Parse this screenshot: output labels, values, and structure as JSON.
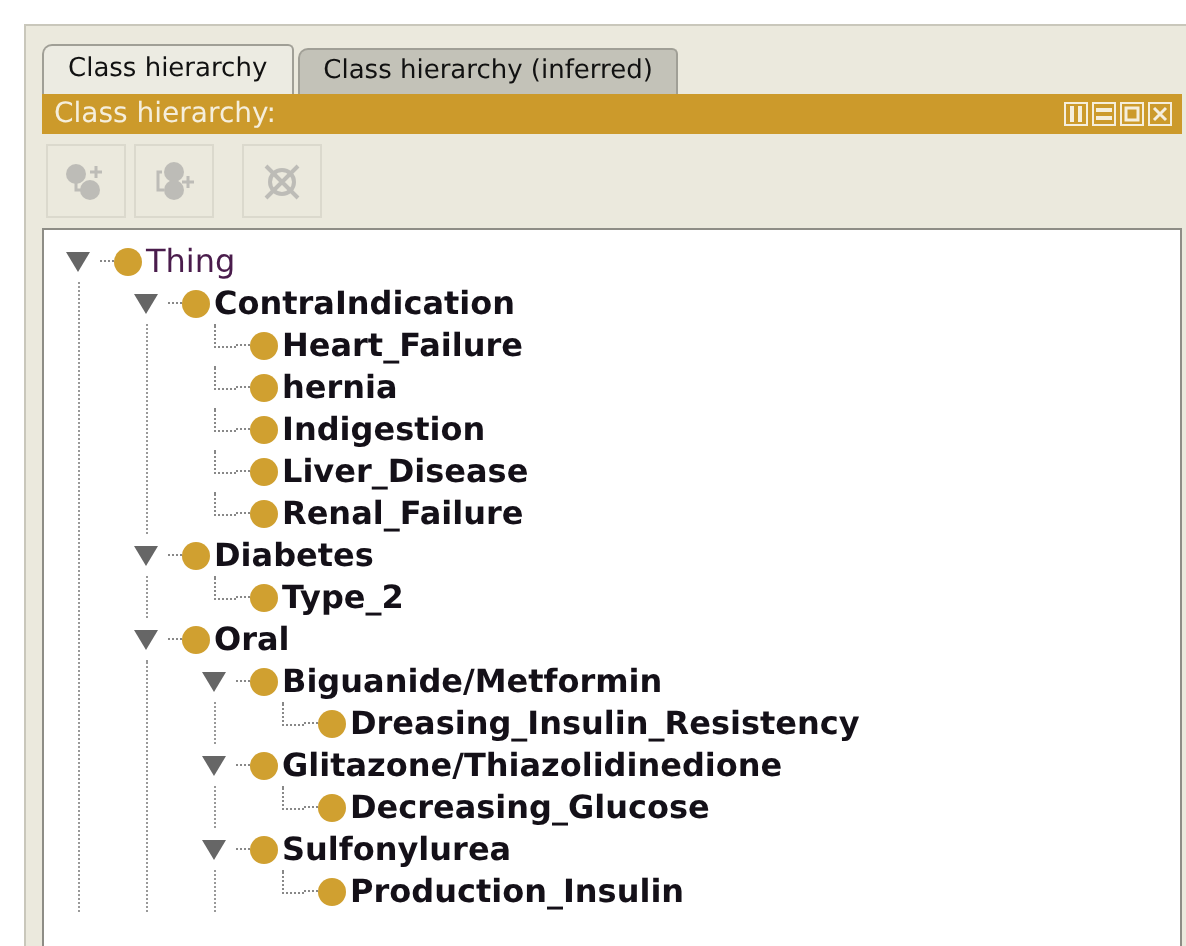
{
  "tabs": [
    {
      "label": "Class hierarchy",
      "selected": true
    },
    {
      "label": "Class hierarchy (inferred)",
      "selected": false
    }
  ],
  "view_header": {
    "title": "Class hierarchy:"
  },
  "toolbar": [
    {
      "kind": "add-subclass",
      "disabled": true
    },
    {
      "kind": "add-sibling",
      "disabled": true
    },
    {
      "kind": "delete",
      "disabled": true
    }
  ],
  "tree": [
    {
      "label": "Thing",
      "expanded": true,
      "children": [
        {
          "label": "ContraIndication",
          "expanded": true,
          "children": [
            {
              "label": "Heart_Failure"
            },
            {
              "label": "hernia"
            },
            {
              "label": "Indigestion"
            },
            {
              "label": "Liver_Disease"
            },
            {
              "label": "Renal_Failure"
            }
          ]
        },
        {
          "label": "Diabetes",
          "expanded": true,
          "children": [
            {
              "label": "Type_2"
            }
          ]
        },
        {
          "label": "Oral",
          "expanded": true,
          "children": [
            {
              "label": "Biguanide/Metformin",
              "expanded": true,
              "children": [
                {
                  "label": "Dreasing_Insulin_Resistency"
                }
              ]
            },
            {
              "label": "Glitazone/Thiazolidinedione",
              "expanded": true,
              "children": [
                {
                  "label": "Decreasing_Glucose"
                }
              ]
            },
            {
              "label": "Sulfonylurea",
              "expanded": true,
              "children": [
                {
                  "label": "Production_Insulin"
                }
              ]
            }
          ]
        }
      ]
    }
  ]
}
